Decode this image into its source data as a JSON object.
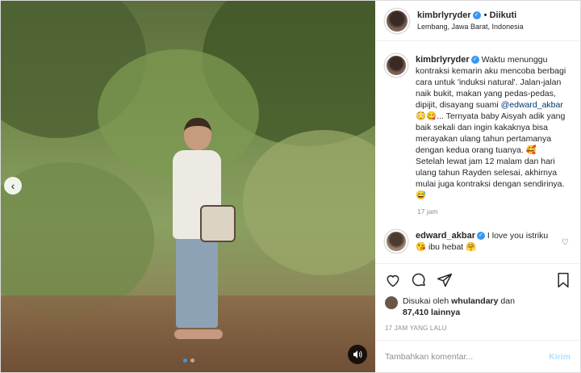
{
  "post": {
    "username": "kimbrlyryder",
    "follow_status": "• Diikuti",
    "location": "Lembang, Jawa Barat, Indonesia",
    "caption_part1": "Waktu menunggu kontraksi kemarin aku mencoba berbagi cara untuk 'induksi natural'. Jalan-jalan naik bukit, makan yang pedas-pedas, dipijit, disayang suami ",
    "caption_mention": "@edward_akbar",
    "caption_part2": " 😳😋... Ternyata baby Aisyah adik yang baik sekali dan ingin kakaknya bisa merayakan ulang tahun pertamanya dengan kedua orang tuanya. 🥰\nSetelah lewat jam 12 malam dan hari ulang tahun Rayden selesai, akhirnya mulai juga kontraksi dengan sendirinya. 😅",
    "caption_time": "17 jam",
    "comment_username": "edward_akbar",
    "comment_text": " I love you istriku 😘 ibu hebat 🤗",
    "likes_prefix": "Disukai oleh ",
    "likes_user": "whulandary",
    "likes_and": " dan",
    "likes_count": "87,410 lainnya",
    "post_date": "17 JAM YANG LALU",
    "comment_placeholder": "Tambahkan komentar...",
    "post_button": "Kirim"
  },
  "icons": {
    "heart": "heart-icon",
    "comment": "comment-icon",
    "share": "share-icon",
    "bookmark": "bookmark-icon",
    "prev": "chevron-left-icon",
    "sound": "speaker-icon"
  },
  "colors": {
    "verified": "#3897f0",
    "link": "#00376b",
    "muted": "#8e8e8e",
    "post_button_disabled": "#b2dffc"
  }
}
